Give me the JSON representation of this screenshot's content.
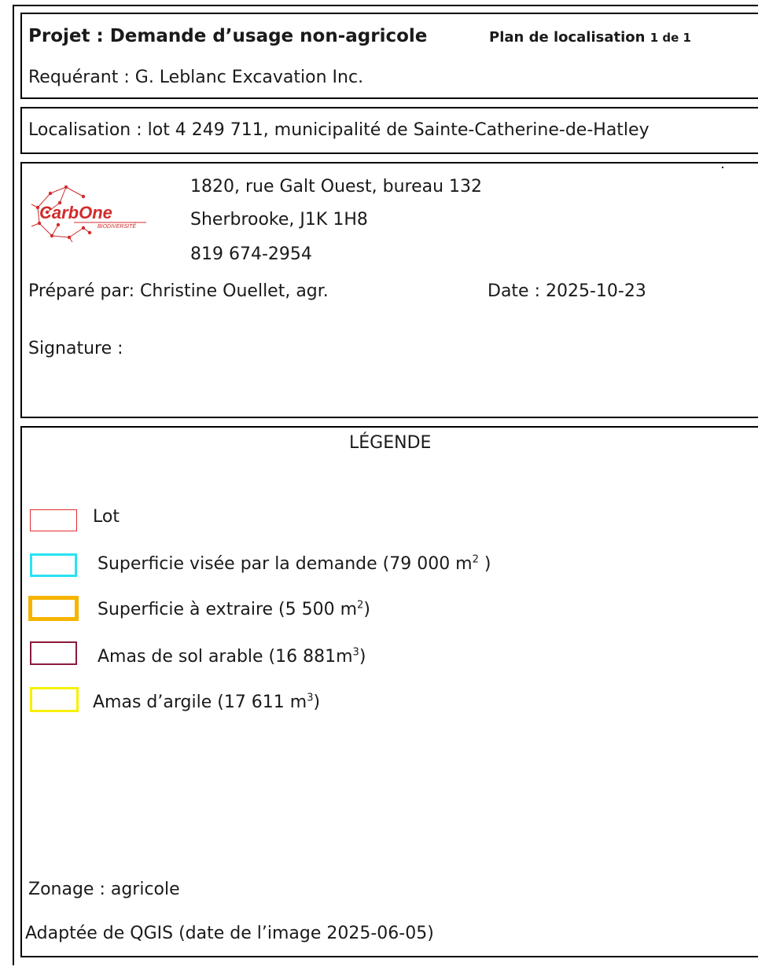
{
  "header": {
    "project": "Projet : Demande d’usage non-agricole",
    "plan_label": "Plan de localisation",
    "plan_pages": "1 de 1",
    "requester": "Requérant : G. Leblanc Excavation Inc."
  },
  "location": {
    "text": "Localisation : lot 4 249 711, municipalité de Sainte-Catherine-de-Hatley"
  },
  "firm": {
    "logo_main": "CarbOne",
    "logo_sub": "BIODIVERSITÉ",
    "address_line1": "1820, rue Galt Ouest, bureau 132",
    "address_line2": "Sherbrooke, J1K 1H8",
    "phone": "819 674-2954",
    "prepared_by": "Préparé par: Christine Ouellet, agr.",
    "date": "Date : 2025-10-23",
    "signature": "Signature :"
  },
  "legend": {
    "title": "LÉGENDE",
    "items": [
      {
        "label": "Lot",
        "unit": "",
        "suffix": "",
        "color": "#e03030"
      },
      {
        "label": "Superficie visée par la demande  (79 000 m",
        "unit": "2",
        "suffix": " )",
        "color": "#29e3f0"
      },
      {
        "label": "Superficie à extraire (5 500 m",
        "unit": "2",
        "suffix": ")",
        "color": "#f5b400"
      },
      {
        "label": "Amas de sol arable (16 881m",
        "unit": "3",
        "suffix": ")",
        "color": "#8b1a3a"
      },
      {
        "label": "Amas d’argile (17 611 m",
        "unit": "3",
        "suffix": ")",
        "color": "#f7f000"
      }
    ],
    "zoning": "Zonage : agricole",
    "source": "Adaptée de QGIS (date de l’image 2025-06-05)"
  }
}
